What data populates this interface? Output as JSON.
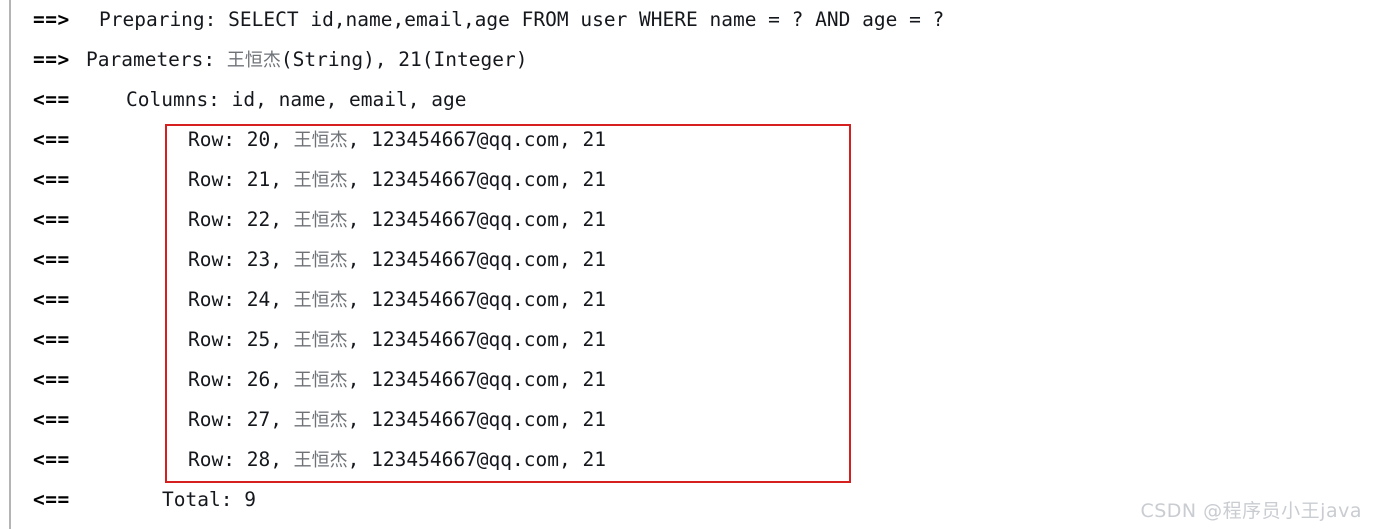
{
  "console": {
    "background_color": "#ffffff",
    "text_color": "#14171c",
    "gutter_color": "#b4b4b4",
    "highlight_color": "#d6201f",
    "cjk_color": "#6e7277"
  },
  "lines": [
    {
      "arrow": "==>",
      "label": "Preparing:",
      "value": " SELECT id,name,email,age FROM user WHERE name = ? AND age = ?",
      "cjk": "",
      "tail": "",
      "kind": "preparing",
      "highlighted": false
    },
    {
      "arrow": "==>",
      "label": "Parameters:",
      "value": " ",
      "cjk": "王恒杰",
      "tail": "(String), 21(Integer)",
      "kind": "parameters",
      "highlighted": false
    },
    {
      "arrow": "<==",
      "label": "Columns:",
      "value": " id, name, email, age",
      "cjk": "",
      "tail": "",
      "kind": "columns",
      "highlighted": false
    },
    {
      "arrow": "<==",
      "label": "Row:",
      "value": " 20, ",
      "cjk": "王恒杰",
      "tail": ", 123454667@qq.com, 21",
      "kind": "row",
      "highlighted": true
    },
    {
      "arrow": "<==",
      "label": "Row:",
      "value": " 21, ",
      "cjk": "王恒杰",
      "tail": ", 123454667@qq.com, 21",
      "kind": "row",
      "highlighted": true
    },
    {
      "arrow": "<==",
      "label": "Row:",
      "value": " 22, ",
      "cjk": "王恒杰",
      "tail": ", 123454667@qq.com, 21",
      "kind": "row",
      "highlighted": true
    },
    {
      "arrow": "<==",
      "label": "Row:",
      "value": " 23, ",
      "cjk": "王恒杰",
      "tail": ", 123454667@qq.com, 21",
      "kind": "row",
      "highlighted": true
    },
    {
      "arrow": "<==",
      "label": "Row:",
      "value": " 24, ",
      "cjk": "王恒杰",
      "tail": ", 123454667@qq.com, 21",
      "kind": "row",
      "highlighted": true
    },
    {
      "arrow": "<==",
      "label": "Row:",
      "value": " 25, ",
      "cjk": "王恒杰",
      "tail": ", 123454667@qq.com, 21",
      "kind": "row",
      "highlighted": true
    },
    {
      "arrow": "<==",
      "label": "Row:",
      "value": " 26, ",
      "cjk": "王恒杰",
      "tail": ", 123454667@qq.com, 21",
      "kind": "row",
      "highlighted": true
    },
    {
      "arrow": "<==",
      "label": "Row:",
      "value": " 27, ",
      "cjk": "王恒杰",
      "tail": ", 123454667@qq.com, 21",
      "kind": "row",
      "highlighted": true
    },
    {
      "arrow": "<==",
      "label": "Row:",
      "value": " 28, ",
      "cjk": "王恒杰",
      "tail": ", 123454667@qq.com, 21",
      "kind": "row",
      "highlighted": true
    },
    {
      "arrow": "<==",
      "label": "Total:",
      "value": " 9",
      "cjk": "",
      "tail": "",
      "kind": "total",
      "highlighted": false
    }
  ],
  "watermark": {
    "text": "CSDN @程序员小王java"
  }
}
